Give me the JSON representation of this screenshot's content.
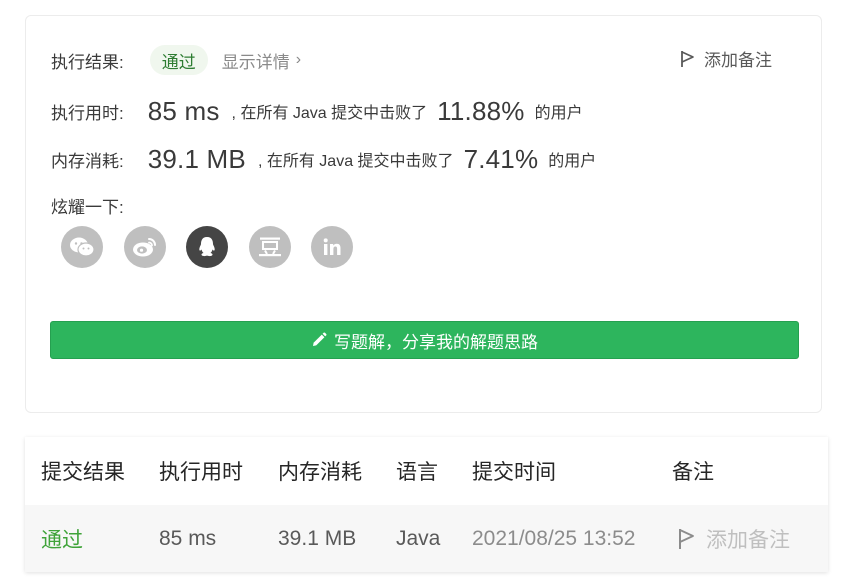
{
  "result": {
    "label": "执行结果:",
    "status": "通过",
    "details_link": "显示详情",
    "add_note": "添加备注"
  },
  "runtime": {
    "label": "执行用时:",
    "value": "85 ms",
    "text_before": ", 在所有 Java 提交中击败了",
    "percent": "11.88%",
    "text_after": "的用户"
  },
  "memory": {
    "label": "内存消耗:",
    "value": "39.1 MB",
    "text_before": ", 在所有 Java 提交中击败了",
    "percent": "7.41%",
    "text_after": "的用户"
  },
  "share": {
    "label": "炫耀一下:",
    "icons": [
      "wechat-icon",
      "weibo-icon",
      "qq-icon",
      "douban-icon",
      "linkedin-icon"
    ]
  },
  "write_button": {
    "label": "写题解，分享我的解题思路"
  },
  "submissions": {
    "headers": [
      "提交结果",
      "执行用时",
      "内存消耗",
      "语言",
      "提交时间",
      "备注"
    ],
    "rows": [
      {
        "status": "通过",
        "runtime": "85 ms",
        "memory": "39.1 MB",
        "language": "Java",
        "time": "2021/08/25 13:52",
        "note": "添加备注"
      }
    ]
  },
  "colors": {
    "accent_green": "#2db55d",
    "pass_text": "#3fa339",
    "icon_gray": "#bfbfbf",
    "icon_dark": "#454545"
  }
}
